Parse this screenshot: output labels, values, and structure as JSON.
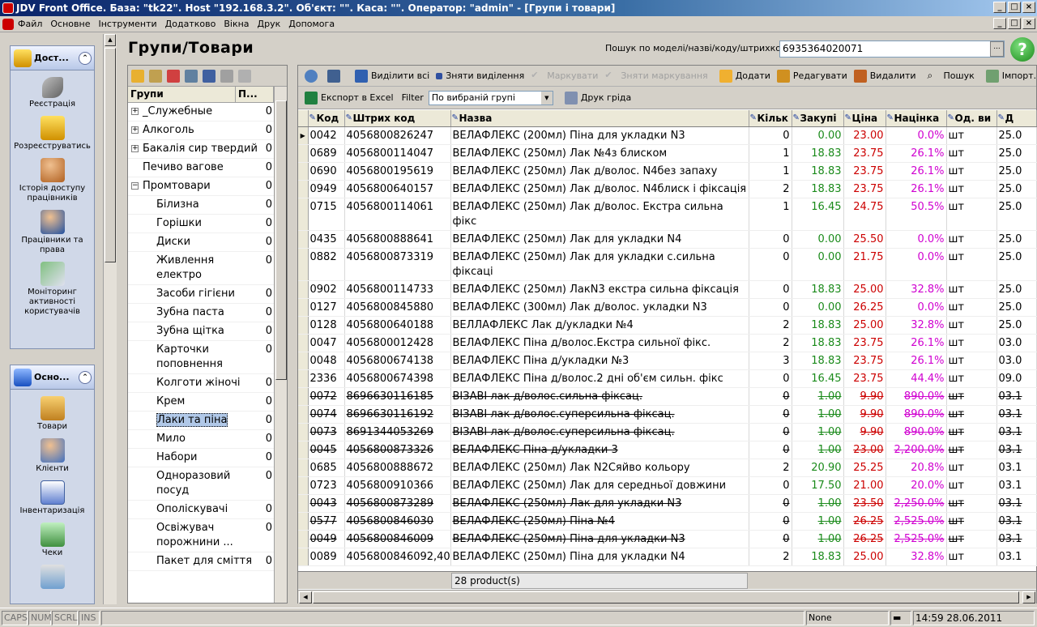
{
  "window": {
    "title": "JDV Front Office. База: \"tk22\". Host \"192.168.3.2\". Об'єкт: \"\". Каса: \"\". Оператор: \"admin\" - [Групи і товари]",
    "controls": [
      "_",
      "□",
      "×"
    ]
  },
  "menu": [
    "Файл",
    "Основне",
    "Інструменти",
    "Додатково",
    "Вікна",
    "Друк",
    "Допомога"
  ],
  "nav": {
    "panel1": {
      "title": "Дост...",
      "items": [
        "Реєстрація",
        "Розреєструватись",
        "Історія доступу працівників",
        "Працівники та права",
        "Моніторинг активності користувачів"
      ]
    },
    "panel2": {
      "title": "Осно...",
      "items": [
        "Товари",
        "Клієнти",
        "Інвентаризація",
        "Чеки"
      ]
    }
  },
  "page": {
    "title": "Групи/Товари",
    "search_label": "Пошук по моделі/назві/коду/штрихкоду:",
    "search_value": "6935364020071"
  },
  "groups": {
    "col_name": "Групи",
    "col_count": "П...",
    "rows": [
      {
        "name": "_Служебные",
        "count": "0",
        "expander": "+"
      },
      {
        "name": "Алкоголь",
        "count": "0",
        "expander": "+"
      },
      {
        "name": "Бакалія сир твердий",
        "count": "0",
        "expander": "+"
      },
      {
        "name": "Печиво вагове",
        "count": "0",
        "expander": ""
      },
      {
        "name": "Промтовари",
        "count": "0",
        "expander": "−"
      },
      {
        "name": "Білизна",
        "count": "0",
        "child": true
      },
      {
        "name": "Горішки",
        "count": "0",
        "child": true
      },
      {
        "name": "Диски",
        "count": "0",
        "child": true
      },
      {
        "name": "Живлення електро",
        "count": "0",
        "child": true
      },
      {
        "name": "Засоби гігієни",
        "count": "0",
        "child": true
      },
      {
        "name": "Зубна паста",
        "count": "0",
        "child": true
      },
      {
        "name": "Зубна щітка",
        "count": "0",
        "child": true
      },
      {
        "name": "Карточки поповнення",
        "count": "0",
        "child": true
      },
      {
        "name": "Колготи жіночі",
        "count": "0",
        "child": true
      },
      {
        "name": "Крем",
        "count": "0",
        "child": true
      },
      {
        "name": "Лаки та піна",
        "count": "0",
        "child": true,
        "selected": true
      },
      {
        "name": "Мило",
        "count": "0",
        "child": true
      },
      {
        "name": "Набори",
        "count": "0",
        "child": true
      },
      {
        "name": "Одноразовий посуд",
        "count": "0",
        "child": true
      },
      {
        "name": "Ополіскувачі",
        "count": "0",
        "child": true
      },
      {
        "name": "Освіжувач порожнини ...",
        "count": "0",
        "child": true
      },
      {
        "name": "Пакет для сміття",
        "count": "0",
        "child": true
      }
    ]
  },
  "toolbar1": {
    "select_all": "Виділити всі",
    "deselect": "Зняти виділення",
    "mark": "Маркувати",
    "unmark": "Зняти маркування",
    "add": "Додати",
    "edit": "Редагувати",
    "delete": "Видалити",
    "search": "Пошук",
    "import": "Імпорт..."
  },
  "toolbar2": {
    "export": "Експорт в Excel",
    "filter_label": "Filter",
    "filter_value": "По вибраній групі",
    "print": "Друк гріда"
  },
  "table": {
    "columns": [
      "Код",
      "Штрих код",
      "Назва",
      "Кільк",
      "Закупі",
      "Ціна",
      "Націнка",
      "Од. ви",
      "Д"
    ],
    "rows": [
      {
        "code": "0042",
        "barcode": "4056800826247",
        "name": "ВЕЛАФЛЕКС (200мл) Піна для укладки N3",
        "qty": "0",
        "buy": "0.00",
        "price": "23.00",
        "markup": "0.0%",
        "unit": "шт",
        "d": "25.0",
        "current": true
      },
      {
        "code": "0689",
        "barcode": "4056800114047",
        "name": "ВЕЛАФЛЕКС (250мл) Лак №4з блиском",
        "qty": "1",
        "buy": "18.83",
        "price": "23.75",
        "markup": "26.1%",
        "unit": "шт",
        "d": "25.0"
      },
      {
        "code": "0690",
        "barcode": "4056800195619",
        "name": "ВЕЛАФЛЕКС (250мл) Лак д/волос. N4без запаху",
        "qty": "1",
        "buy": "18.83",
        "price": "23.75",
        "markup": "26.1%",
        "unit": "шт",
        "d": "25.0"
      },
      {
        "code": "0949",
        "barcode": "4056800640157",
        "name": "ВЕЛАФЛЕКС (250мл) Лак д/волос. N4блиск і фіксація",
        "qty": "2",
        "buy": "18.83",
        "price": "23.75",
        "markup": "26.1%",
        "unit": "шт",
        "d": "25.0"
      },
      {
        "code": "0715",
        "barcode": "4056800114061",
        "name": "ВЕЛАФЛЕКС (250мл) Лак д/волос. Екстра сильна фікс",
        "qty": "1",
        "buy": "16.45",
        "price": "24.75",
        "markup": "50.5%",
        "unit": "шт",
        "d": "25.0",
        "tall": true
      },
      {
        "code": "0435",
        "barcode": "4056800888641",
        "name": "ВЕЛАФЛЕКС (250мл) Лак для укладки N4",
        "qty": "0",
        "buy": "0.00",
        "price": "25.50",
        "markup": "0.0%",
        "unit": "шт",
        "d": "25.0"
      },
      {
        "code": "0882",
        "barcode": "4056800873319",
        "name": "ВЕЛАФЛЕКС (250мл) Лак для укладки с.сильна фіксаці",
        "qty": "0",
        "buy": "0.00",
        "price": "21.75",
        "markup": "0.0%",
        "unit": "шт",
        "d": "25.0",
        "tall": true
      },
      {
        "code": "0902",
        "barcode": "4056800114733",
        "name": "ВЕЛАФЛЕКС (250мл) ЛакN3 екстра сильна фіксація",
        "qty": "0",
        "buy": "18.83",
        "price": "25.00",
        "markup": "32.8%",
        "unit": "шт",
        "d": "25.0"
      },
      {
        "code": "0127",
        "barcode": "4056800845880",
        "name": "ВЕЛАФЛЕКС (300мл) Лак д/волос. укладки N3",
        "qty": "0",
        "buy": "0.00",
        "price": "26.25",
        "markup": "0.0%",
        "unit": "шт",
        "d": "25.0"
      },
      {
        "code": "0128",
        "barcode": "4056800640188",
        "name": "ВЕЛЛАФЛЕКС Лак д/укладки №4",
        "qty": "2",
        "buy": "18.83",
        "price": "25.00",
        "markup": "32.8%",
        "unit": "шт",
        "d": "25.0"
      },
      {
        "code": "0047",
        "barcode": "4056800012428",
        "name": "ВЕЛАФЛЕКС  Піна д/волос.Екстра сильної фікс.",
        "qty": "2",
        "buy": "18.83",
        "price": "23.75",
        "markup": "26.1%",
        "unit": "шт",
        "d": "03.0"
      },
      {
        "code": "0048",
        "barcode": "4056800674138",
        "name": "ВЕЛАФЛЕКС  Піна д/укладки №3",
        "qty": "3",
        "buy": "18.83",
        "price": "23.75",
        "markup": "26.1%",
        "unit": "шт",
        "d": "03.0"
      },
      {
        "code": "2336",
        "barcode": "4056800674398",
        "name": "ВЕЛАФЛЕКС  Піна д/волос.2 дні об'єм сильн. фікс",
        "qty": "0",
        "buy": "16.45",
        "price": "23.75",
        "markup": "44.4%",
        "unit": "шт",
        "d": "09.0"
      },
      {
        "code": "0072",
        "barcode": "8696630116185",
        "name": "ВІЗАВІ лак д/волос.сильна фіксац.",
        "qty": "0",
        "buy": "1.00",
        "price": "9.90",
        "markup": "890.0%",
        "unit": "шт",
        "d": "03.1",
        "strike": true
      },
      {
        "code": "0074",
        "barcode": "8696630116192",
        "name": "ВІЗАВІ лак д/волос.суперсильна фіксац.",
        "qty": "0",
        "buy": "1.00",
        "price": "9.90",
        "markup": "890.0%",
        "unit": "шт",
        "d": "03.1",
        "strike": true
      },
      {
        "code": "0073",
        "barcode": "8691344053269",
        "name": "ВІЗАВІ лак д/волос.суперсильна фіксац.",
        "qty": "0",
        "buy": "1.00",
        "price": "9.90",
        "markup": "890.0%",
        "unit": "шт",
        "d": "03.1",
        "strike": true
      },
      {
        "code": "0045",
        "barcode": "4056800873326",
        "name": "ВЕЛАФЛЕКС  Піна д/укладки 3",
        "qty": "0",
        "buy": "1.00",
        "price": "23.00",
        "markup": "2,200.0%",
        "unit": "шт",
        "d": "03.1",
        "strike": true
      },
      {
        "code": "0685",
        "barcode": "4056800888672",
        "name": "ВЕЛАФЛЕКС (250мл) Лак N2Сяйво кольору",
        "qty": "2",
        "buy": "20.90",
        "price": "25.25",
        "markup": "20.8%",
        "unit": "шт",
        "d": "03.1"
      },
      {
        "code": "0723",
        "barcode": "4056800910366",
        "name": "ВЕЛАФЛЕКС (250мл) Лак для середньої довжини",
        "qty": "0",
        "buy": "17.50",
        "price": "21.00",
        "markup": "20.0%",
        "unit": "шт",
        "d": "03.1"
      },
      {
        "code": "0043",
        "barcode": "4056800873289",
        "name": "ВЕЛАФЛЕКС (250мл) Лак для укладки N3",
        "qty": "0",
        "buy": "1.00",
        "price": "23.50",
        "markup": "2,250.0%",
        "unit": "шт",
        "d": "03.1",
        "strike": true
      },
      {
        "code": "0577",
        "barcode": "4056800846030",
        "name": "ВЕЛАФЛЕКС (250мл) Піна №4",
        "qty": "0",
        "buy": "1.00",
        "price": "26.25",
        "markup": "2,525.0%",
        "unit": "шт",
        "d": "03.1",
        "strike": true
      },
      {
        "code": "0049",
        "barcode": "4056800846009",
        "name": "ВЕЛАФЛЕКС (250мл) Піна для укладки N3",
        "qty": "0",
        "buy": "1.00",
        "price": "26.25",
        "markup": "2,525.0%",
        "unit": "шт",
        "d": "03.1",
        "strike": true
      },
      {
        "code": "0089",
        "barcode": "4056800846092,40",
        "name": "ВЕЛАФЛЕКС (250мл) Піна для укладки N4",
        "qty": "2",
        "buy": "18.83",
        "price": "25.00",
        "markup": "32.8%",
        "unit": "шт",
        "d": "03.1"
      }
    ],
    "footer_count": "28 product(s)"
  },
  "status": {
    "caps": "CAPS",
    "num": "NUM",
    "scrl": "SCRL",
    "ins": "INS",
    "none": "None",
    "datetime": "14:59 28.06.2011"
  },
  "colors": {
    "positive": "#1a8a1a",
    "price": "#cc0000",
    "markup": "#d000d0",
    "titlebar": "#0a246a"
  }
}
